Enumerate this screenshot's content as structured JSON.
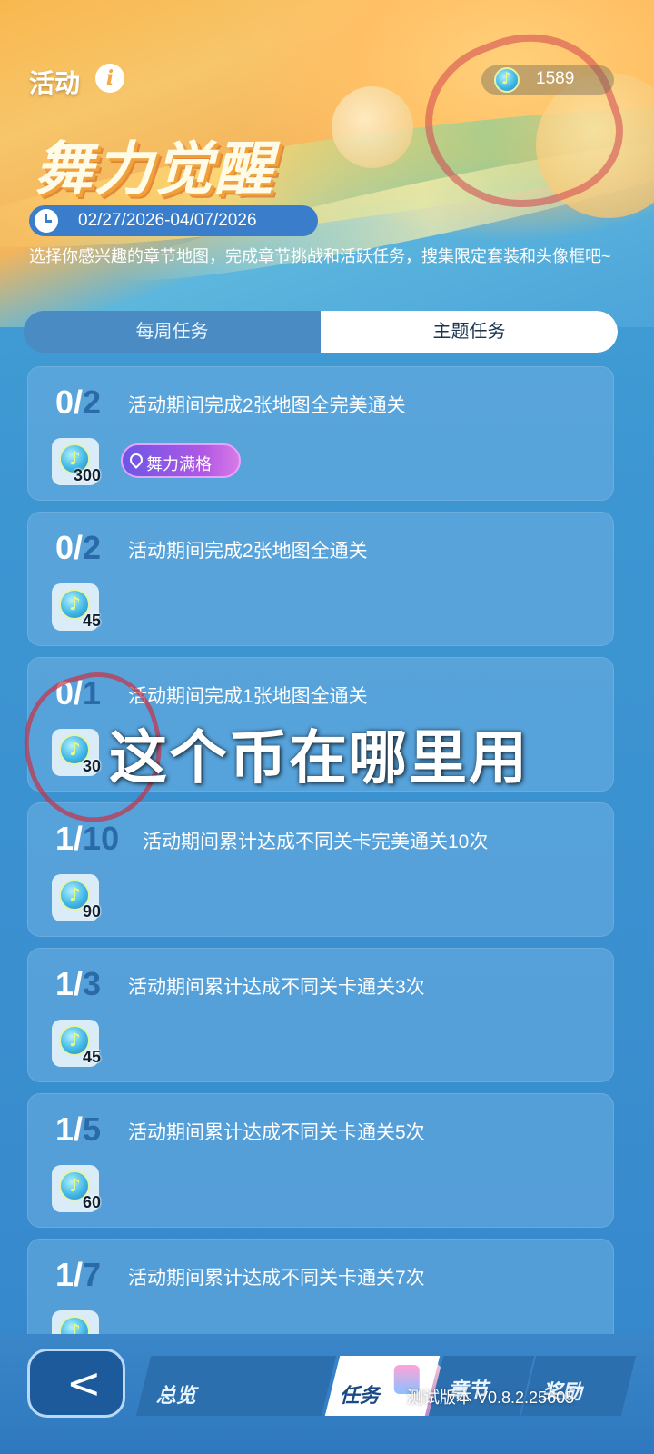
{
  "header": {
    "section_title": "活动",
    "coins": "1589",
    "event_title": "舞力觉醒",
    "date_range": "02/27/2026-04/07/2026",
    "description": "选择你感兴趣的章节地图，完成章节挑战和活跃任务，搜集限定套装和头像框吧~"
  },
  "tabs": [
    {
      "label": "每周任务",
      "active": false
    },
    {
      "label": "主题任务",
      "active": true
    }
  ],
  "tasks": [
    {
      "current": "0",
      "total": "2",
      "desc": "活动期间完成2张地图全完美通关",
      "reward": "300",
      "badge": "舞力满格"
    },
    {
      "current": "0",
      "total": "2",
      "desc": "活动期间完成2张地图全通关",
      "reward": "45"
    },
    {
      "current": "0",
      "total": "1",
      "desc": "活动期间完成1张地图全通关",
      "reward": "30"
    },
    {
      "current": "1",
      "total": "10",
      "desc": "活动期间累计达成不同关卡完美通关10次",
      "reward": "90"
    },
    {
      "current": "1",
      "total": "3",
      "desc": "活动期间累计达成不同关卡通关3次",
      "reward": "45"
    },
    {
      "current": "1",
      "total": "5",
      "desc": "活动期间累计达成不同关卡通关5次",
      "reward": "60"
    },
    {
      "current": "1",
      "total": "7",
      "desc": "活动期间累计达成不同关卡通关7次",
      "reward": ""
    }
  ],
  "overlay_text": "这个币在哪里用",
  "bottom_nav": {
    "back": "<",
    "overview": "总览",
    "tasks": "任务",
    "chapter": "章节",
    "reward": "奖励",
    "version": "测试版本 V0.8.2.25605"
  },
  "colors": {
    "accent_blue": "#3a7ecb",
    "progress_total": "#2a6aa8",
    "badge_purple": "#8a56e4",
    "annotation_red": "#c83246"
  }
}
